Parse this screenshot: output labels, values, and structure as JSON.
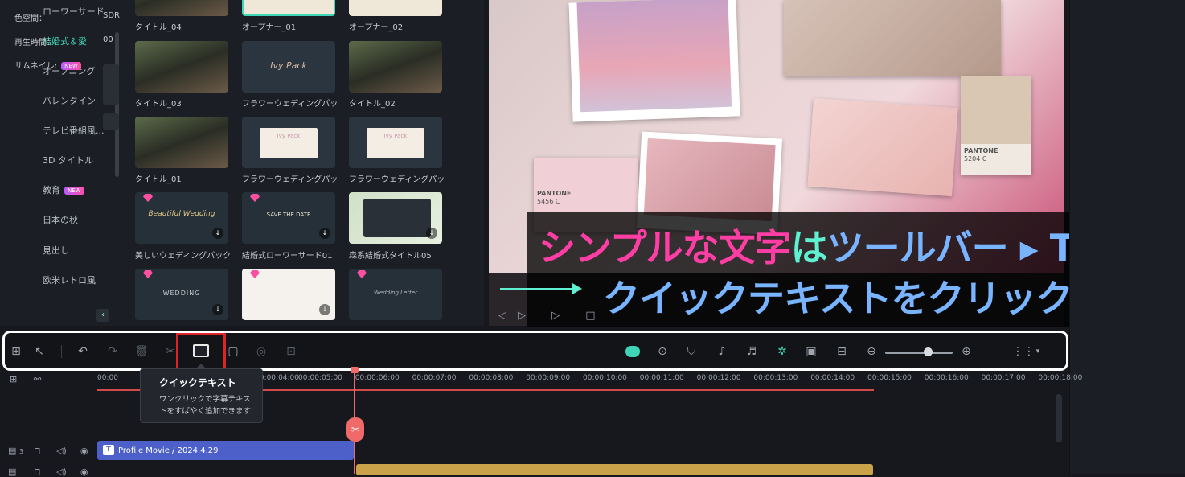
{
  "sidebar": {
    "categories": [
      {
        "label": "ローワーサード",
        "active": false
      },
      {
        "label": "結婚式＆愛",
        "active": true
      },
      {
        "label": "オープニング",
        "active": false
      },
      {
        "label": "バレンタイン",
        "active": false
      },
      {
        "label": "テレビ番組風...",
        "active": false
      },
      {
        "label": "3D タイトル",
        "active": false
      },
      {
        "label": "教育",
        "badge": "NEW",
        "active": false
      },
      {
        "label": "日本の秋",
        "active": false
      },
      {
        "label": "見出し",
        "active": false
      },
      {
        "label": "欧米レトロ風",
        "active": false
      }
    ],
    "collapse_icon": "chevron-left-icon"
  },
  "templates": [
    {
      "label": "タイトル_04"
    },
    {
      "label": "オープナー_01"
    },
    {
      "label": "オープナー_02"
    },
    {
      "label": "タイトル_03",
      "thumb_text": "Ivy Pack"
    },
    {
      "label": "フラワーウェディングパック ..."
    },
    {
      "label": "タイトル_02"
    },
    {
      "label": "タイトル_01",
      "thumb_text": "Ivy Pack"
    },
    {
      "label": "フラワーウェディングパック ...",
      "thumb_text": "Ivy Pack"
    },
    {
      "label": "フラワーウェディングパック ..."
    },
    {
      "label": "美しいウェディングパック タ...",
      "thumb_text": "Beautiful Wedding"
    },
    {
      "label": "結婚式ローワーサード01",
      "thumb_text": "SAVE THE DATE"
    },
    {
      "label": "森系結婚式タイトル05"
    },
    {
      "label": "",
      "thumb_text": "WEDDING"
    },
    {
      "label": ""
    },
    {
      "label": "",
      "thumb_text": "Wedding Letter"
    }
  ],
  "preview": {
    "pantone_a": "PANTONE",
    "pantone_a_code": "5456 C",
    "pantone_b": "PANTONE",
    "pantone_b_code": "5204 C",
    "caption_line1_pink": "シンプルな文字",
    "caption_line1_teal": "は",
    "caption_line1_blue": "ツールバー ▸ T",
    "caption_line2": "クイックテキストをクリック",
    "controls": "◁▷ ▷ □"
  },
  "properties": {
    "color_space_label": "色空間：",
    "color_space_value": "SDR",
    "duration_label": "再生時間：",
    "duration_value": "00",
    "thumbnail_label": "サムネイル:",
    "thumbnail_badge": "NEW"
  },
  "toolbar": {
    "icons": [
      "grid-icon",
      "select-cursor-icon",
      "undo-icon",
      "redo-icon",
      "delete-icon",
      "scissors-icon",
      "quick-text-icon",
      "crop-icon",
      "color-palette-icon",
      "text-replace-icon"
    ],
    "right_icons": [
      "record-icon",
      "playback-icon",
      "marker-icon",
      "microphone-icon",
      "audio-clip-icon",
      "ai-icon",
      "pip-icon",
      "split-screen-icon",
      "zoom-out-icon",
      "zoom-in-icon",
      "layout-icon"
    ]
  },
  "tooltip": {
    "title": "クイックテキスト",
    "body": "ワンクリックで字幕テキストをすばやく追加できます"
  },
  "timeline": {
    "ticks": [
      "00:00",
      "00:00:04:00",
      "00:00:05:00",
      "00:00:06:00",
      "00:00:07:00",
      "00:00:08:00",
      "00:00:09:00",
      "00:00:10:00",
      "00:00:11:00",
      "00:00:12:00",
      "00:00:13:00",
      "00:00:14:00",
      "00:00:15:00",
      "00:00:16:00",
      "00:00:17:00",
      "00:00:18:00"
    ],
    "clip1_label": "Profile Movie / 2024.4.29",
    "clip1_icon": "T",
    "track_num": "3"
  },
  "colors": {
    "accent": "#3fd6b8",
    "pink_caption": "#ff3ea5",
    "blue_caption": "#78b4ff",
    "clip_blue": "#4d60c9",
    "clip_gold": "#caa24a",
    "playhead": "#f06a6a"
  }
}
